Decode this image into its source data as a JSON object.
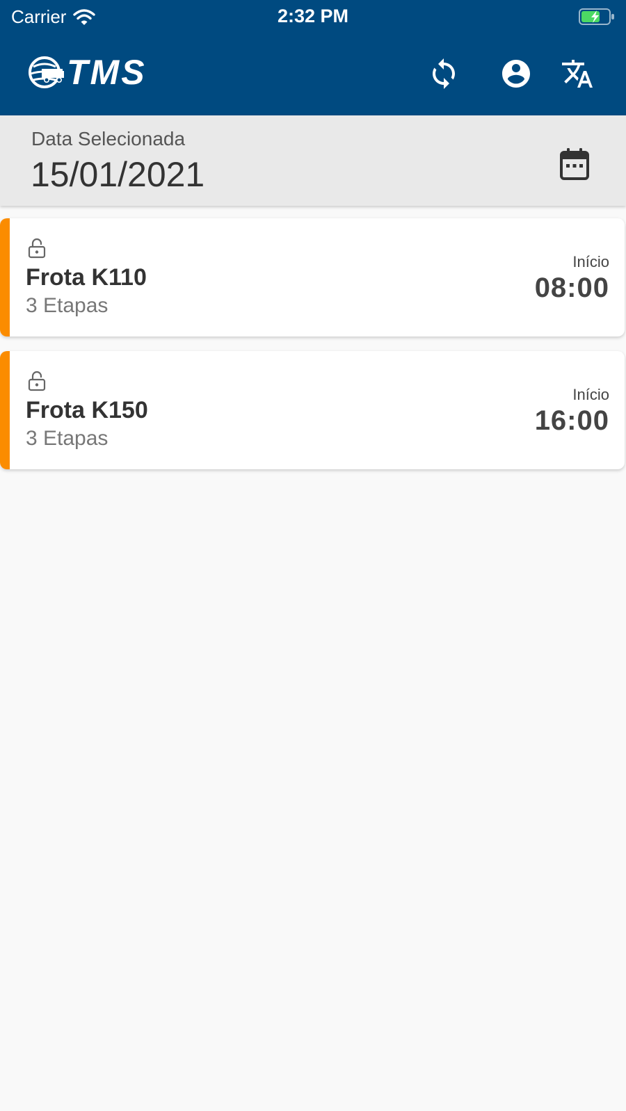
{
  "status_bar": {
    "carrier": "Carrier",
    "time": "2:32 PM",
    "battery_color": "#4cd964"
  },
  "header": {
    "logo_text": "TMS",
    "background": "#004a80",
    "icons": [
      "sync-icon",
      "account-circle-icon",
      "translate-icon"
    ]
  },
  "date_panel": {
    "label": "Data Selecionada",
    "value": "15/01/2021",
    "icon": "calendar-icon"
  },
  "trips": [
    {
      "title": "Frota K110",
      "subtitle": "3 Etapas",
      "start_label": "Início",
      "start_time": "08:00",
      "icon": "unlocked-icon",
      "accent_color": "#fb8c00"
    },
    {
      "title": "Frota K150",
      "subtitle": "3 Etapas",
      "start_label": "Início",
      "start_time": "16:00",
      "icon": "unlocked-icon",
      "accent_color": "#fb8c00"
    }
  ]
}
